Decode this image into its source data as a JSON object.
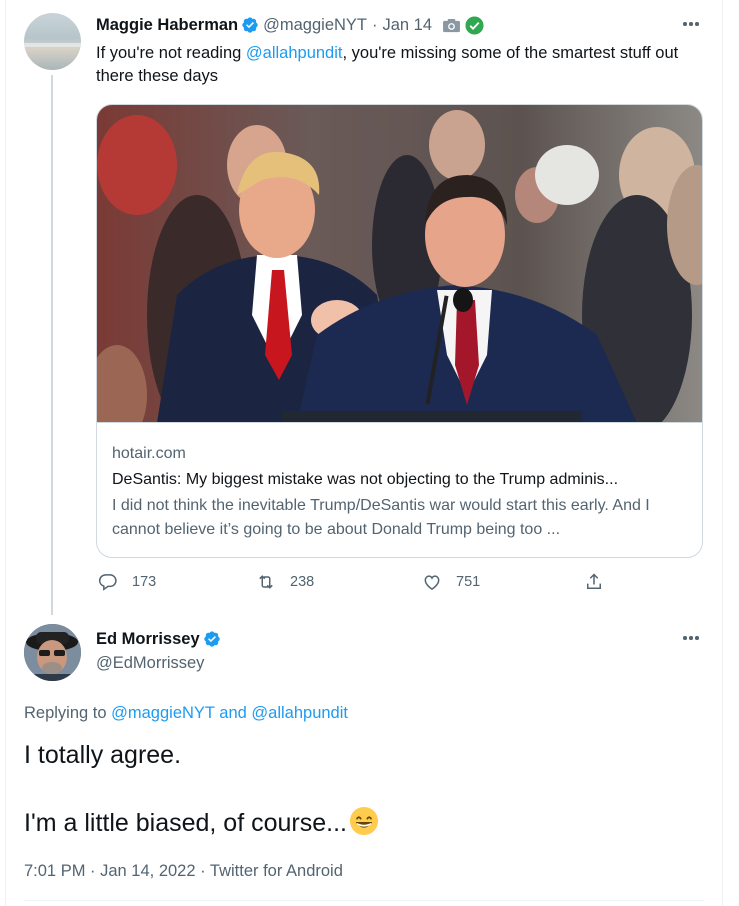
{
  "quoted_tweet": {
    "author_name": "Maggie Haberman",
    "handle": "@maggieNYT",
    "separator": "·",
    "date": "Jan 14",
    "text_before": "If you're not reading ",
    "text_mention": "@allahpundit",
    "text_after": ", you're missing some of the smartest stuff out there these days",
    "icons": [
      "verified-badge-icon",
      "camera-icon",
      "green-check-icon",
      "more-options-icon"
    ],
    "card": {
      "image_icon": "news-photo",
      "domain": "hotair.com",
      "title": "DeSantis: My biggest mistake was not objecting to the Trump adminis...",
      "description": "I did not think the inevitable Trump/DeSantis war would start this early. And I cannot believe it’s going to be about Donald Trump being too ..."
    },
    "actions": {
      "reply_count": "173",
      "retweet_count": "238",
      "like_count": "751",
      "icons": [
        "reply-icon",
        "retweet-icon",
        "like-icon",
        "share-icon"
      ]
    }
  },
  "main_tweet": {
    "author_name": "Ed Morrissey",
    "handle": "@EdMorrissey",
    "replying_prefix": "Replying to ",
    "replying_user1": "@maggieNYT",
    "replying_and": " and ",
    "replying_user2": "@allahpundit",
    "line1": "I totally agree.",
    "line2": "I'm a little biased, of course...",
    "emoji_icon": "grinning-face-emoji",
    "time": "7:01 PM",
    "meta_sep": " · ",
    "date": "Jan 14, 2022",
    "source": "Twitter for Android"
  },
  "colors": {
    "link": "#1d9bf0",
    "secondary_text": "#536471",
    "primary_text": "#0f1419",
    "verified": "#1d9bf0",
    "border": "#cfd9de"
  }
}
